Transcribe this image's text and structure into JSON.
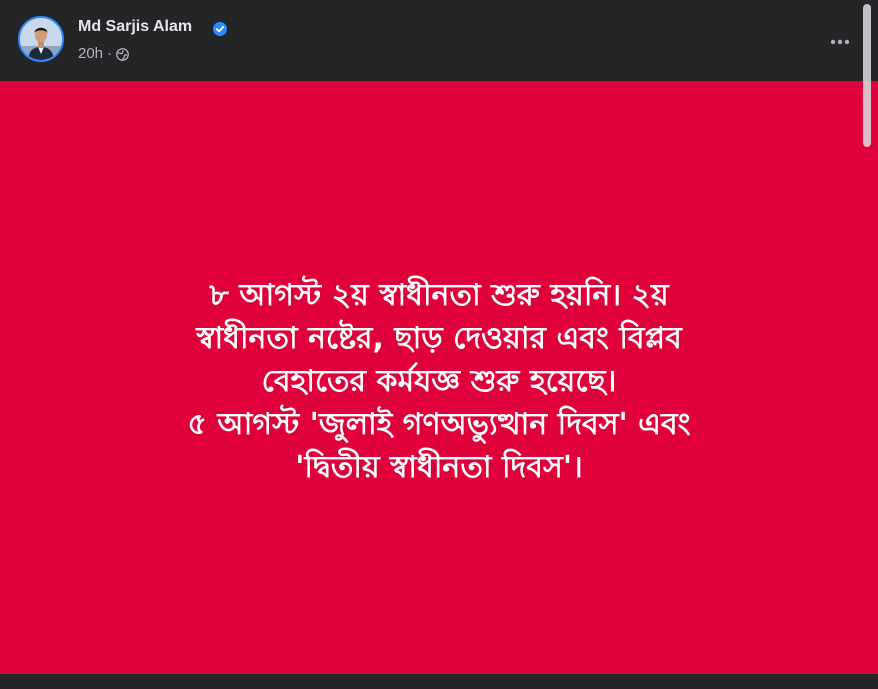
{
  "post": {
    "author": {
      "name": "Md Sarjis Alam",
      "verified": true,
      "avatar_icon": "profile-photo"
    },
    "meta": {
      "time": "20h",
      "separator": "·",
      "audience_icon": "globe-icon"
    },
    "more_icon": "more-horizontal-icon",
    "image": {
      "background_color": "#e0003a",
      "text_color": "#ffffff",
      "lines": [
        "৮ আগস্ট ২য় স্বাধীনতা শুরু হয়নি। ২য়",
        "স্বাধীনতা নষ্টের, ছাড় দেওয়ার এবং বিপ্লব",
        "বেহাতের কর্মযজ্ঞ শুরু হয়েছে।",
        "৫ আগস্ট 'জুলাই গণঅভ্যুত্থান দিবস' এবং",
        "'দ্বিতীয় স্বাধীনতা দিবস'।"
      ]
    }
  },
  "colors": {
    "header_bg": "#242526",
    "name_text": "#e4e6eb",
    "meta_text": "#b0b3b8",
    "verified_blue": "#2d88ff"
  }
}
